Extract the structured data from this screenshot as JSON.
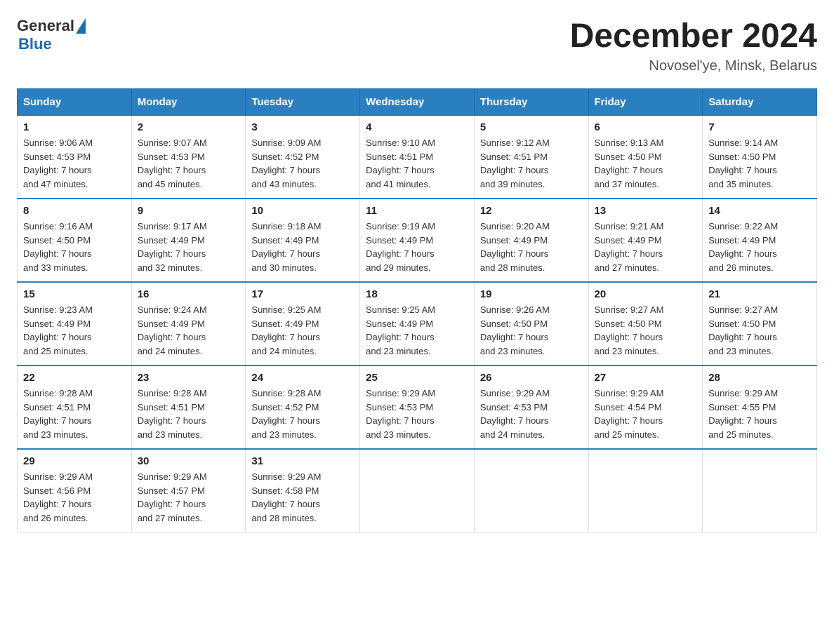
{
  "header": {
    "logo_general": "General",
    "logo_blue": "Blue",
    "title": "December 2024",
    "location": "Novosel'ye, Minsk, Belarus"
  },
  "days_of_week": [
    "Sunday",
    "Monday",
    "Tuesday",
    "Wednesday",
    "Thursday",
    "Friday",
    "Saturday"
  ],
  "weeks": [
    [
      {
        "day": "1",
        "sunrise": "9:06 AM",
        "sunset": "4:53 PM",
        "daylight": "7 hours and 47 minutes."
      },
      {
        "day": "2",
        "sunrise": "9:07 AM",
        "sunset": "4:53 PM",
        "daylight": "7 hours and 45 minutes."
      },
      {
        "day": "3",
        "sunrise": "9:09 AM",
        "sunset": "4:52 PM",
        "daylight": "7 hours and 43 minutes."
      },
      {
        "day": "4",
        "sunrise": "9:10 AM",
        "sunset": "4:51 PM",
        "daylight": "7 hours and 41 minutes."
      },
      {
        "day": "5",
        "sunrise": "9:12 AM",
        "sunset": "4:51 PM",
        "daylight": "7 hours and 39 minutes."
      },
      {
        "day": "6",
        "sunrise": "9:13 AM",
        "sunset": "4:50 PM",
        "daylight": "7 hours and 37 minutes."
      },
      {
        "day": "7",
        "sunrise": "9:14 AM",
        "sunset": "4:50 PM",
        "daylight": "7 hours and 35 minutes."
      }
    ],
    [
      {
        "day": "8",
        "sunrise": "9:16 AM",
        "sunset": "4:50 PM",
        "daylight": "7 hours and 33 minutes."
      },
      {
        "day": "9",
        "sunrise": "9:17 AM",
        "sunset": "4:49 PM",
        "daylight": "7 hours and 32 minutes."
      },
      {
        "day": "10",
        "sunrise": "9:18 AM",
        "sunset": "4:49 PM",
        "daylight": "7 hours and 30 minutes."
      },
      {
        "day": "11",
        "sunrise": "9:19 AM",
        "sunset": "4:49 PM",
        "daylight": "7 hours and 29 minutes."
      },
      {
        "day": "12",
        "sunrise": "9:20 AM",
        "sunset": "4:49 PM",
        "daylight": "7 hours and 28 minutes."
      },
      {
        "day": "13",
        "sunrise": "9:21 AM",
        "sunset": "4:49 PM",
        "daylight": "7 hours and 27 minutes."
      },
      {
        "day": "14",
        "sunrise": "9:22 AM",
        "sunset": "4:49 PM",
        "daylight": "7 hours and 26 minutes."
      }
    ],
    [
      {
        "day": "15",
        "sunrise": "9:23 AM",
        "sunset": "4:49 PM",
        "daylight": "7 hours and 25 minutes."
      },
      {
        "day": "16",
        "sunrise": "9:24 AM",
        "sunset": "4:49 PM",
        "daylight": "7 hours and 24 minutes."
      },
      {
        "day": "17",
        "sunrise": "9:25 AM",
        "sunset": "4:49 PM",
        "daylight": "7 hours and 24 minutes."
      },
      {
        "day": "18",
        "sunrise": "9:25 AM",
        "sunset": "4:49 PM",
        "daylight": "7 hours and 23 minutes."
      },
      {
        "day": "19",
        "sunrise": "9:26 AM",
        "sunset": "4:50 PM",
        "daylight": "7 hours and 23 minutes."
      },
      {
        "day": "20",
        "sunrise": "9:27 AM",
        "sunset": "4:50 PM",
        "daylight": "7 hours and 23 minutes."
      },
      {
        "day": "21",
        "sunrise": "9:27 AM",
        "sunset": "4:50 PM",
        "daylight": "7 hours and 23 minutes."
      }
    ],
    [
      {
        "day": "22",
        "sunrise": "9:28 AM",
        "sunset": "4:51 PM",
        "daylight": "7 hours and 23 minutes."
      },
      {
        "day": "23",
        "sunrise": "9:28 AM",
        "sunset": "4:51 PM",
        "daylight": "7 hours and 23 minutes."
      },
      {
        "day": "24",
        "sunrise": "9:28 AM",
        "sunset": "4:52 PM",
        "daylight": "7 hours and 23 minutes."
      },
      {
        "day": "25",
        "sunrise": "9:29 AM",
        "sunset": "4:53 PM",
        "daylight": "7 hours and 23 minutes."
      },
      {
        "day": "26",
        "sunrise": "9:29 AM",
        "sunset": "4:53 PM",
        "daylight": "7 hours and 24 minutes."
      },
      {
        "day": "27",
        "sunrise": "9:29 AM",
        "sunset": "4:54 PM",
        "daylight": "7 hours and 25 minutes."
      },
      {
        "day": "28",
        "sunrise": "9:29 AM",
        "sunset": "4:55 PM",
        "daylight": "7 hours and 25 minutes."
      }
    ],
    [
      {
        "day": "29",
        "sunrise": "9:29 AM",
        "sunset": "4:56 PM",
        "daylight": "7 hours and 26 minutes."
      },
      {
        "day": "30",
        "sunrise": "9:29 AM",
        "sunset": "4:57 PM",
        "daylight": "7 hours and 27 minutes."
      },
      {
        "day": "31",
        "sunrise": "9:29 AM",
        "sunset": "4:58 PM",
        "daylight": "7 hours and 28 minutes."
      },
      null,
      null,
      null,
      null
    ]
  ],
  "labels": {
    "sunrise": "Sunrise:",
    "sunset": "Sunset:",
    "daylight": "Daylight:"
  }
}
